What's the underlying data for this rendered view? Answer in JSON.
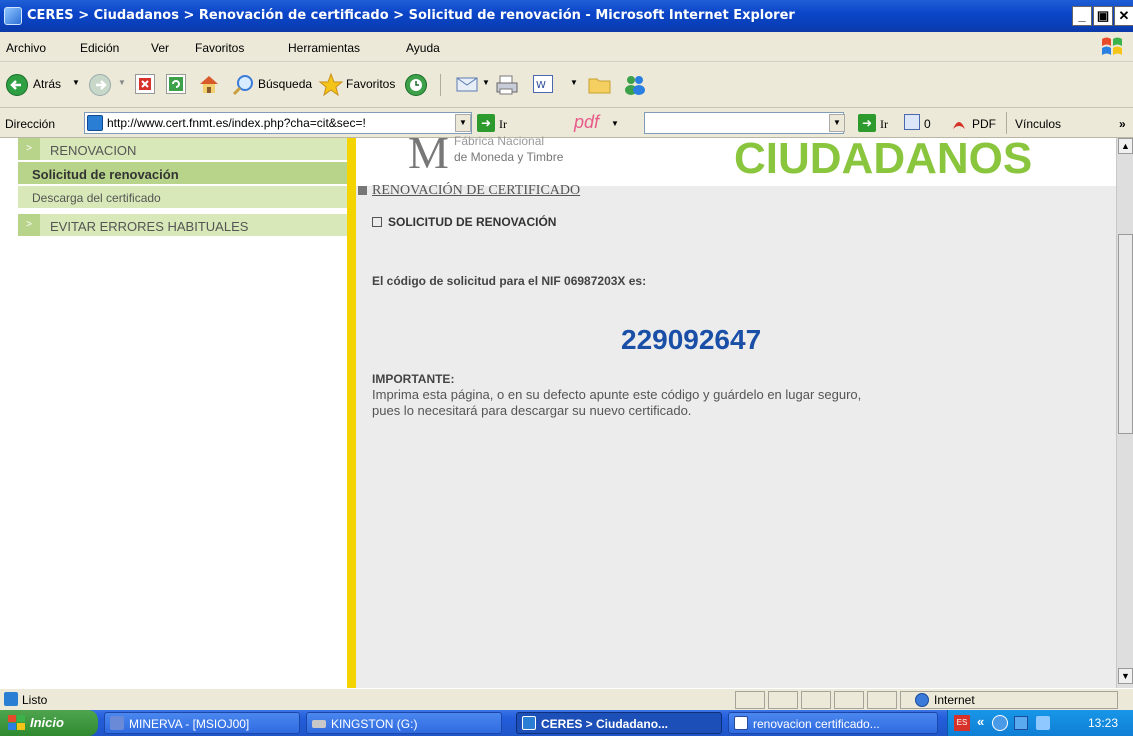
{
  "window": {
    "title": "CERES > Ciudadanos > Renovación de certificado > Solicitud de renovación - Microsoft Internet Explorer",
    "min_glyph": "_",
    "max_glyph": "▣",
    "close_glyph": "✕"
  },
  "menu": {
    "items": [
      "Archivo",
      "Edición",
      "Ver",
      "Favoritos",
      "Herramientas",
      "Ayuda"
    ]
  },
  "toolbar": {
    "back_label": "Atrás",
    "search_label": "Búsqueda",
    "favorites_label": "Favoritos"
  },
  "address": {
    "label": "Dirección",
    "url": "http://www.cert.fnmt.es/index.php?cha=cit&sec=!",
    "go_label": "Ir",
    "pdf_logo": "pdf",
    "go2_label": "Ir",
    "count_label": "0",
    "pdf_label": "PDF",
    "links_label": "Vínculos",
    "more_glyph": "»"
  },
  "sidebar": {
    "items": [
      {
        "label": "RENOVACION",
        "bullet": ">"
      },
      {
        "label": "Solicitud de renovación"
      },
      {
        "label": "Descarga del certificado"
      },
      {
        "label": "EVITAR ERRORES HABITUALES",
        "bullet": ">"
      }
    ]
  },
  "header": {
    "logo_glyph": "M",
    "org_line1": "Fábrica Nacional",
    "org_line2": "de Moneda y Timbre",
    "section_title": "CIUDADANOS"
  },
  "main": {
    "breadcrumb": "RENOVACIÓN DE CERTIFICADO",
    "subtitle": "SOLICITUD DE RENOVACIÓN",
    "code_intro": "El código de solicitud para el NIF 06987203X es:",
    "code": "229092647",
    "important_label": "IMPORTANTE:",
    "important_line1": "Imprima esta página, o en su defecto apunte este código y guárdelo en lugar seguro,",
    "important_line2": "pues lo necesitará para descargar su nuevo certificado."
  },
  "status": {
    "text": "Listo",
    "zone": "Internet"
  },
  "taskbar": {
    "start_label": "Inicio",
    "tasks": [
      "MINERVA - [MSIOJ00]",
      "KINGSTON (G:)",
      "CERES > Ciudadano...",
      "renovacion certificado..."
    ],
    "tray_arrows": "«",
    "clock": "13:23"
  },
  "colors": {
    "title_blue": "#0b45c9",
    "sidebar_green": "#d8e8b8",
    "sidebar_active": "#b7d48a",
    "divider_yellow": "#f3d400",
    "brand_green": "#8ac53e",
    "code_blue": "#1a4fa8"
  }
}
